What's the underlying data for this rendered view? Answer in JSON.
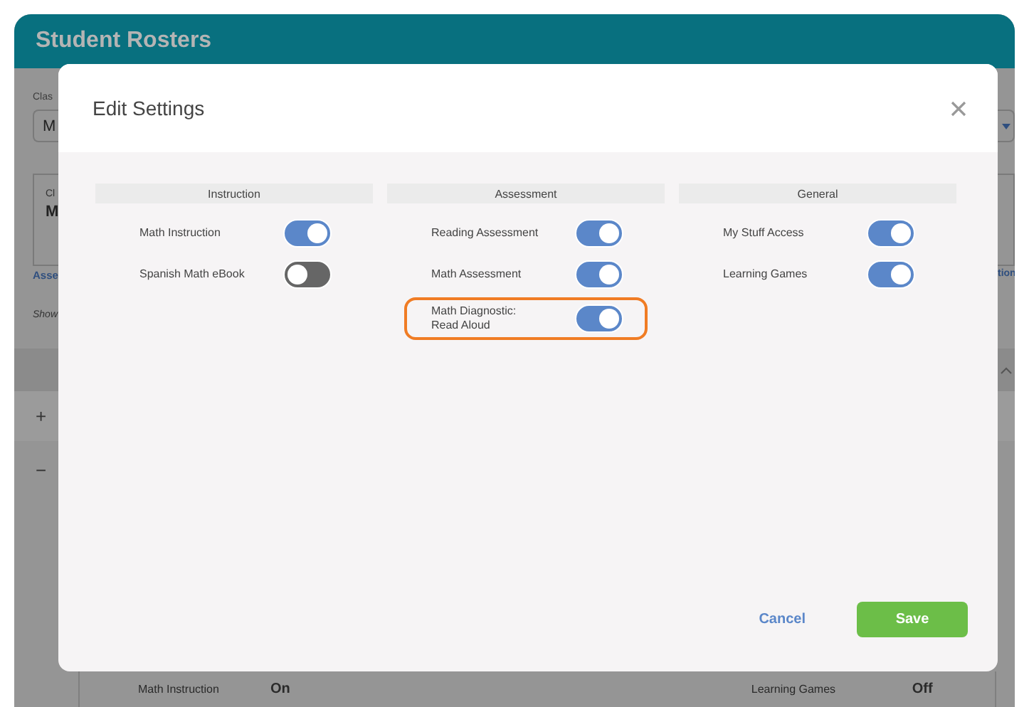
{
  "page": {
    "title": "Student Rosters",
    "class_label": "Clas",
    "class_select": "M",
    "card_label": "Cl",
    "card_value": "M",
    "link_left": "Asse",
    "link_right": "tion",
    "show_label": "Show",
    "expand_button": "+",
    "collapse_button": "−",
    "summary": [
      {
        "label": "Math Instruction",
        "value": "On"
      },
      {
        "label": "Learning Games",
        "value": "Off"
      }
    ]
  },
  "dialog": {
    "title": "Edit Settings",
    "sections": [
      {
        "heading": "Instruction",
        "settings": [
          {
            "label": "Math Instruction",
            "on": true,
            "highlighted": false
          },
          {
            "label": "Spanish Math eBook",
            "on": false,
            "highlighted": false
          }
        ]
      },
      {
        "heading": "Assessment",
        "settings": [
          {
            "label": "Reading Assessment",
            "on": true,
            "highlighted": false
          },
          {
            "label": "Math Assessment",
            "on": true,
            "highlighted": false
          },
          {
            "label": "Math Diagnostic:\nRead Aloud",
            "on": true,
            "highlighted": true
          }
        ]
      },
      {
        "heading": "General",
        "settings": [
          {
            "label": "My Stuff Access",
            "on": true,
            "highlighted": false
          },
          {
            "label": "Learning Games",
            "on": true,
            "highlighted": false
          }
        ]
      }
    ],
    "buttons": [
      {
        "label": "Cancel",
        "kind": "link"
      },
      {
        "label": "Save",
        "kind": "primary"
      }
    ]
  }
}
